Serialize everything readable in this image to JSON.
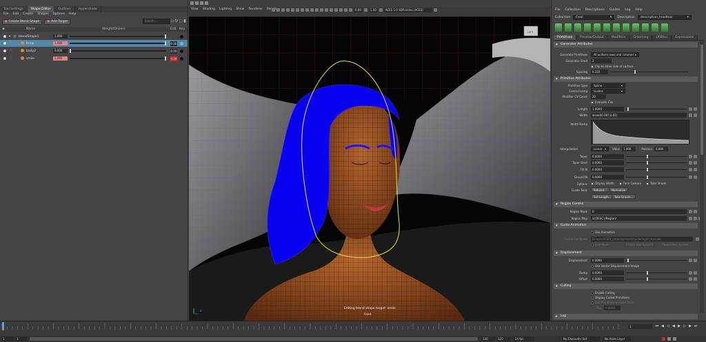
{
  "shape_editor": {
    "tabs": [
      "Tool Settings",
      "Shape Editor",
      "Outliner",
      "Hypershade"
    ],
    "menu": [
      "File",
      "Edit",
      "Create",
      "Shapes",
      "Options",
      "Help"
    ],
    "create_btn": "Create Blend Shape",
    "add_target_btn": "Add Target",
    "search_placeholder": "Search...",
    "columns": {
      "name": "Name",
      "weight": "Weight/Drivers",
      "edit": "Edit",
      "key": "Key"
    },
    "rows": [
      {
        "name": "blendShape1",
        "value": "1.000",
        "slider": 1.0,
        "edit": ""
      },
      {
        "name": "brow",
        "value": "1.000",
        "slider": 1.0,
        "edit": "0.00",
        "selected": true
      },
      {
        "name": "body2",
        "value": "0.000",
        "slider": 0.0,
        "edit": "0.00"
      },
      {
        "name": "smile",
        "value": "1.000",
        "slider": 1.0,
        "edit": "0.00",
        "editing": true
      }
    ]
  },
  "viewport": {
    "menu": [
      "View",
      "Shading",
      "Lighting",
      "Show",
      "Renderer",
      "Panels"
    ],
    "field1": "0.00",
    "field2": "1.00",
    "colorspace": "ACES 1.0 SDR-video (ACES)",
    "hud_message": "Editing blend shape target: smile",
    "camera_name": "front",
    "cube_label": "LEFT",
    "axis_label": "Z"
  },
  "xgen": {
    "menu": [
      "File",
      "Collection",
      "Descriptions",
      "Guides",
      "Log",
      "Help"
    ],
    "collection_label": "Collection",
    "collection_value": "Final",
    "description_label": "Description",
    "description_value": "description_headhair",
    "tabs": [
      "Primitives",
      "Preview/Output",
      "Modifiers",
      "Grooming",
      "Utilities",
      "Expressions"
    ],
    "generator": {
      "title": "Generator Attributes",
      "generate_label": "Generate Primitives",
      "generate_value": "At uniform rows and columns",
      "seed_label": "Generator Seed",
      "seed_value": "2",
      "clip_label": "Clip to other side of surface",
      "spacing_label": "Spacing",
      "spacing_value": "0.155"
    },
    "primitive": {
      "title": "Primitive Attributes",
      "type_label": "Primitive Type",
      "type_value": "Spline",
      "control_label": "Control using",
      "control_value": "Guides",
      "cv_label": "Modifier CV Count",
      "cv_value": "20",
      "cvs_label": "Evaluate CVs",
      "length_label": "Length",
      "length_value": "1.0000",
      "width_label": "Width",
      "width_value": "$rand(0.007,0.02)",
      "ramp_label": "Width Ramp",
      "interp_label": "Interpolation",
      "interp_value": "Linear",
      "value_label": "Value",
      "value_value": "1.000",
      "position_label": "Position",
      "position_value": "0.000",
      "taper_label": "Taper",
      "taper_value": "0.0000",
      "taper_start_label": "Taper Start",
      "taper_start_value": "0.0000",
      "tilt_label": "Tilt N",
      "tilt_value": "0.0000",
      "ground_label": "Ground N",
      "ground_value": "0.0000",
      "options_label": "Options",
      "display_width": "Display Width",
      "face_camera": "Face Camera",
      "tube_shade": "Tube Shade",
      "guide_tools_label": "Guide Tools",
      "rebuild_btn": "Rebuild...",
      "normalize_btn": "Normalize",
      "set_length_btn": "Set Length...",
      "take_groom_btn": "Take Groom..."
    },
    "region": {
      "title": "Region Control",
      "mask_label": "Region Mask",
      "mask_value": "0",
      "map_label": "Region Map",
      "map_value": "${DESC}/Region/"
    },
    "guide_anim": {
      "title": "Guide Animation",
      "use_anim": "Use Animation",
      "cache_label": "Cache File Name",
      "cache_value": "D:/user/XGEN_project/project/cache/xgen_hair.abc",
      "live_mode": "Live Mode",
      "create_hair": "Create Hair System",
      "attach_hair": "Attach Hair System"
    },
    "displacement": {
      "title": "Displacement",
      "disp_label": "Displacement",
      "disp_value": "0.0000",
      "use_vector": "Use Vector Displacement Image",
      "bump_label": "Bump",
      "bump_value": "0.0000",
      "offset_label": "Offset",
      "offset_value": "0.0000"
    },
    "culling": {
      "title": "Culling",
      "enable": "Enable Culling",
      "display": "Display Culled Primitives",
      "cull_back": "Cull Primitives on back faces",
      "flip_label": "Flip",
      "flip_value": "0.0000"
    },
    "log_title": "Log"
  },
  "timeline": {
    "current_frame": "1",
    "range_start": "1",
    "range_end": "120",
    "anim_start": "1.00",
    "anim_end": "1.00",
    "fps": "24 fps",
    "char_set": "No Character Set",
    "anim_layer": "No Anim Layer"
  }
}
